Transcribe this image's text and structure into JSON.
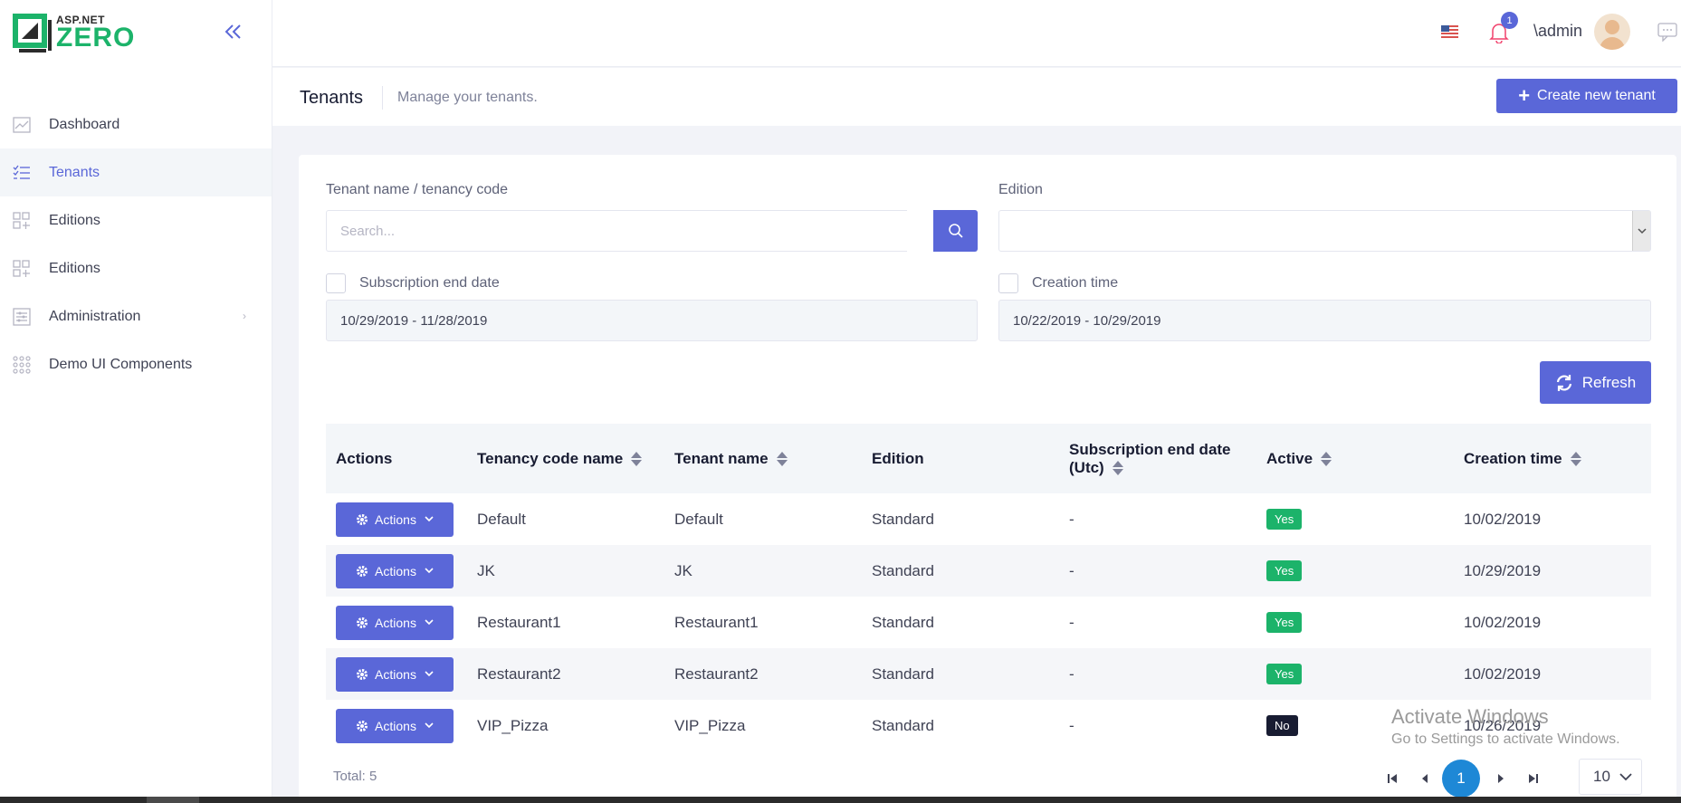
{
  "brand": {
    "top": "ASP.NET",
    "bottom": "ZERO"
  },
  "sidebar": {
    "items": [
      {
        "label": "Dashboard",
        "icon": "chart-icon",
        "active": false
      },
      {
        "label": "Tenants",
        "icon": "list-icon",
        "active": true
      },
      {
        "label": "Editions",
        "icon": "grid-icon",
        "active": false
      },
      {
        "label": "Editions",
        "icon": "grid-icon",
        "active": false
      },
      {
        "label": "Administration",
        "icon": "sliders-icon",
        "active": false,
        "has_children": true
      },
      {
        "label": "Demo UI Components",
        "icon": "dots-grid-icon",
        "active": false
      }
    ]
  },
  "topbar": {
    "notification_count": "1",
    "user": "\\admin"
  },
  "subheader": {
    "title": "Tenants",
    "description": "Manage your tenants.",
    "create_label": "Create new tenant"
  },
  "filters": {
    "search_label": "Tenant name / tenancy code",
    "search_placeholder": "Search...",
    "edition_label": "Edition",
    "edition_value": "",
    "subscription_label": "Subscription end date",
    "subscription_range": "10/29/2019 - 11/28/2019",
    "creation_label": "Creation time",
    "creation_range": "10/22/2019 - 10/29/2019",
    "refresh_label": "Refresh"
  },
  "table": {
    "headers": {
      "actions": "Actions",
      "tenancy_code": "Tenancy code name",
      "tenant_name": "Tenant name",
      "edition": "Edition",
      "subscription_line1": "Subscription end date",
      "subscription_line2": "(Utc)",
      "active": "Active",
      "creation_time": "Creation time"
    },
    "action_label": "Actions",
    "rows": [
      {
        "code": "Default",
        "name": "Default",
        "edition": "Standard",
        "subscription": "-",
        "active": "Yes",
        "created": "10/02/2019"
      },
      {
        "code": "JK",
        "name": "JK",
        "edition": "Standard",
        "subscription": "-",
        "active": "Yes",
        "created": "10/29/2019"
      },
      {
        "code": "Restaurant1",
        "name": "Restaurant1",
        "edition": "Standard",
        "subscription": "-",
        "active": "Yes",
        "created": "10/02/2019"
      },
      {
        "code": "Restaurant2",
        "name": "Restaurant2",
        "edition": "Standard",
        "subscription": "-",
        "active": "Yes",
        "created": "10/02/2019"
      },
      {
        "code": "VIP_Pizza",
        "name": "VIP_Pizza",
        "edition": "Standard",
        "subscription": "-",
        "active": "No",
        "created": "10/26/2019"
      }
    ]
  },
  "pagination": {
    "total": "Total: 5",
    "current_page": "1",
    "page_size": "10"
  },
  "watermark": {
    "line1": "Activate Windows",
    "line2": "Go to Settings to activate Windows."
  },
  "colors": {
    "primary": "#5a67d8",
    "success": "#1cb36a",
    "dark": "#181c32",
    "brand_green": "#1cb36a",
    "pager_current": "#1e88d6"
  }
}
